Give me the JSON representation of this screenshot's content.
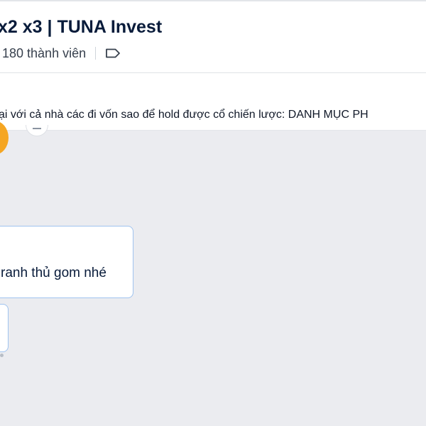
{
  "header": {
    "title": "x2 x3 | TUNA Invest",
    "member_count": "180 thành viên",
    "icons": {
      "tag": "tag-icon"
    }
  },
  "pinned": {
    "text": "ại với cả nhà các đi vốn sao để hold được cổ chiến lược: DANH MỤC PH"
  },
  "messages": [
    {
      "text": "ranh thủ gom nhé"
    }
  ],
  "colors": {
    "title": "#081b3a",
    "chat_background": "#ebecf0",
    "bubble_border": "#9fc3ef",
    "avatar": "#f5a623"
  }
}
